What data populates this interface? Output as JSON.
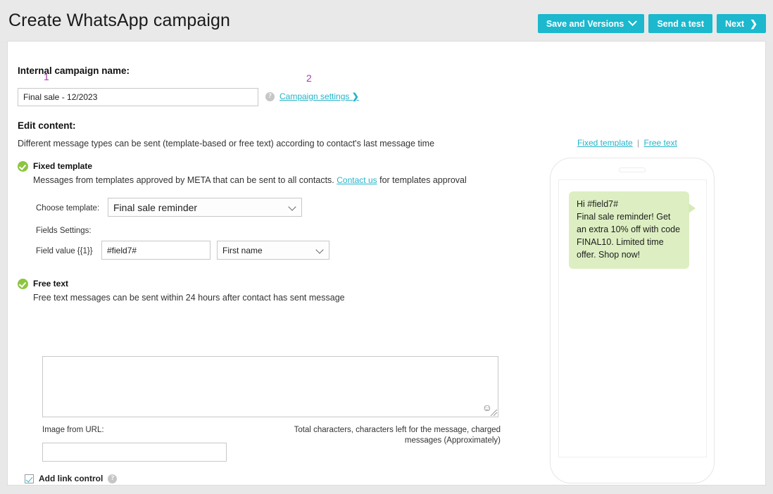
{
  "header": {
    "title": "Create WhatsApp campaign",
    "buttons": {
      "save_versions": "Save and Versions",
      "send_test": "Send a test",
      "next": "Next",
      "next_chevron": "❯"
    },
    "accent_color": "#1bb8ce"
  },
  "annotations": {
    "one": "1",
    "two": "2",
    "color": "#a53fa5"
  },
  "campaign": {
    "name_label": "Internal campaign name:",
    "name_value": "Final sale - 12/2023",
    "name_placeholder": "",
    "help_glyph": "?",
    "settings_link": "Campaign settings",
    "settings_chevron": "❯"
  },
  "edit_content": {
    "heading": "Edit content:",
    "description": "Different message types can be sent (template-based or free text) according to contact's last message time"
  },
  "fixed_template": {
    "title": "Fixed template",
    "description_before": "Messages from templates approved by META that can be sent to all contacts.",
    "contact_link": "Contact us",
    "description_after": "for templates approval",
    "choose_template_label": "Choose template:",
    "template_selected": "Final sale reminder",
    "fields_settings_label": "Fields Settings:",
    "field_value_label": "Field value {{1}}",
    "field_value": "#field7#",
    "field_mapping_selected": "First name"
  },
  "free_text": {
    "title": "Free text",
    "description": "Free text messages can be sent within 24 hours after contact has sent message",
    "textarea_value": "",
    "textarea_placeholder": "",
    "emoji_glyph": "☺",
    "counter_line1": "Total   characters,   characters left for the message,   charged",
    "counter_line2": "messages (Approximately)",
    "image_url_label": "Image from URL:",
    "image_url_value": "",
    "image_url_placeholder": "",
    "add_link_control_label": "Add link control",
    "add_link_control_checked": true,
    "link_help_glyph": "?"
  },
  "preview": {
    "tab_fixed_template": "Fixed template",
    "tab_separator": "|",
    "tab_free_text": "Free text",
    "bubble_text": "Hi #field7#\nFinal sale reminder! Get an extra 10% off with code FINAL10. Limited time offer. Shop now!",
    "bubble_color": "#ddefc2"
  }
}
